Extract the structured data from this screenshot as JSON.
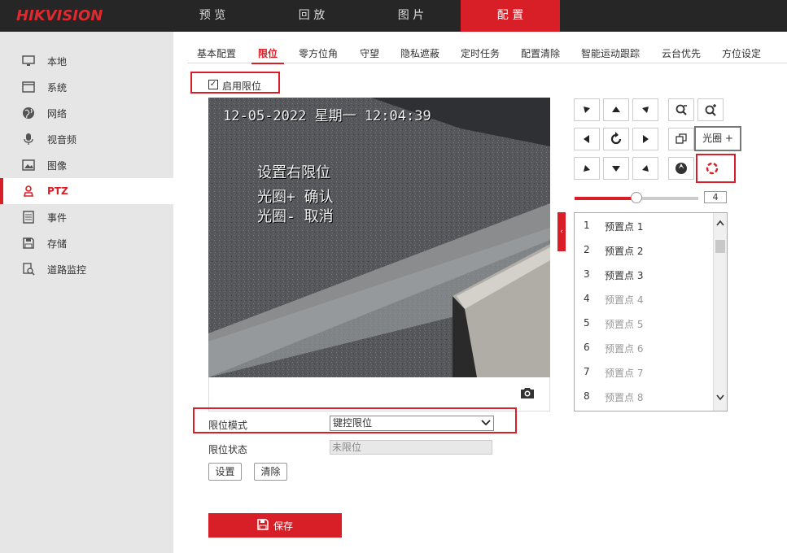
{
  "brand": {
    "logo_text_red": "HIK",
    "logo_text_gray": "VISION",
    "accent": "#d81e26"
  },
  "topnav": [
    {
      "label": "预 览",
      "active": false
    },
    {
      "label": "回 放",
      "active": false
    },
    {
      "label": "图 片",
      "active": false
    },
    {
      "label": "配 置",
      "active": true
    }
  ],
  "sidebar": {
    "items": [
      {
        "label": "本地",
        "icon": "monitor-icon"
      },
      {
        "label": "系统",
        "icon": "window-icon"
      },
      {
        "label": "网络",
        "icon": "globe-icon"
      },
      {
        "label": "视音频",
        "icon": "microphone-icon"
      },
      {
        "label": "图像",
        "icon": "image-icon"
      },
      {
        "label": "PTZ",
        "icon": "ptz-person-icon",
        "active": true
      },
      {
        "label": "事件",
        "icon": "list-icon"
      },
      {
        "label": "存储",
        "icon": "floppy-disk-icon"
      },
      {
        "label": "道路监控",
        "icon": "search-document-icon"
      }
    ]
  },
  "tabs": [
    {
      "label": "基本配置"
    },
    {
      "label": "限位",
      "active": true
    },
    {
      "label": "零方位角"
    },
    {
      "label": "守望"
    },
    {
      "label": "隐私遮蔽"
    },
    {
      "label": "定时任务"
    },
    {
      "label": "配置清除"
    },
    {
      "label": "智能运动跟踪"
    },
    {
      "label": "云台优先"
    },
    {
      "label": "方位设定"
    }
  ],
  "enable_limit": {
    "label": "启用限位",
    "checked": true
  },
  "video": {
    "timestamp": "12-05-2022 星期一 12:04:39",
    "osd_lines": [
      "设置右限位",
      "光圈+ 确认",
      "光圈- 取消"
    ]
  },
  "ptz": {
    "speed_value": "4",
    "speed_fraction": 0.5,
    "tooltip": "光圈 +"
  },
  "presets": [
    {
      "num": "1",
      "name": "预置点 1",
      "set": true
    },
    {
      "num": "2",
      "name": "预置点 2",
      "set": true
    },
    {
      "num": "3",
      "name": "预置点 3",
      "set": true
    },
    {
      "num": "4",
      "name": "预置点 4",
      "set": false
    },
    {
      "num": "5",
      "name": "预置点 5",
      "set": false
    },
    {
      "num": "6",
      "name": "预置点 6",
      "set": false
    },
    {
      "num": "7",
      "name": "预置点 7",
      "set": false
    },
    {
      "num": "8",
      "name": "预置点 8",
      "set": false
    }
  ],
  "form": {
    "mode_label": "限位模式",
    "mode_value": "键控限位",
    "status_label": "限位状态",
    "status_value": "未限位",
    "set_button": "设置",
    "clear_button": "清除",
    "save_button": "保存"
  }
}
